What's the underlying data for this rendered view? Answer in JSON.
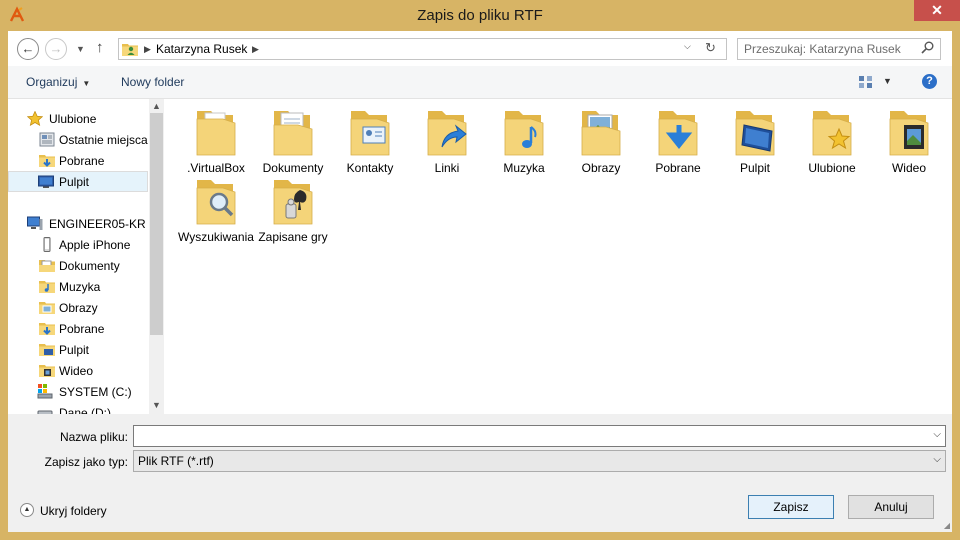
{
  "window": {
    "title": "Zapis do pliku RTF",
    "close_glyph": "✕",
    "app_icon": "app-logo-icon"
  },
  "address": {
    "back_glyph": "←",
    "forward_glyph": "→",
    "up_glyph": "↑",
    "crumbs": [
      "Katarzyna Rusek"
    ],
    "search_placeholder": "Przeszukaj: Katarzyna Rusek"
  },
  "toolbar": {
    "organize": "Organizuj",
    "new_folder": "Nowy folder",
    "help_glyph": "?"
  },
  "nav": {
    "favorites_header": "Ulubione",
    "favorites": [
      "Ostatnie miejsca",
      "Pobrane",
      "Pulpit"
    ],
    "computer_header": "ENGINEER05-KR",
    "computer": [
      "Apple iPhone",
      "Dokumenty",
      "Muzyka",
      "Obrazy",
      "Pobrane",
      "Pulpit",
      "Wideo",
      "SYSTEM (C:)",
      "Dane (D:)"
    ],
    "selected": "Pulpit"
  },
  "files": [
    {
      "label": ".VirtualBox",
      "icon": "folder-icon"
    },
    {
      "label": "Dokumenty",
      "icon": "documents-folder-icon"
    },
    {
      "label": "Kontakty",
      "icon": "contacts-folder-icon"
    },
    {
      "label": "Linki",
      "icon": "links-folder-icon"
    },
    {
      "label": "Muzyka",
      "icon": "music-folder-icon"
    },
    {
      "label": "Obrazy",
      "icon": "pictures-folder-icon"
    },
    {
      "label": "Pobrane",
      "icon": "downloads-folder-icon"
    },
    {
      "label": "Pulpit",
      "icon": "desktop-folder-icon"
    },
    {
      "label": "Ulubione",
      "icon": "favorites-folder-icon"
    },
    {
      "label": "Wideo",
      "icon": "videos-folder-icon"
    },
    {
      "label": "Wyszukiwania",
      "icon": "searches-folder-icon"
    },
    {
      "label": "Zapisane gry",
      "icon": "saved-games-folder-icon"
    }
  ],
  "form": {
    "filename_label": "Nazwa pliku:",
    "filename_value": "",
    "type_label": "Zapisz jako typ:",
    "type_value": "Plik RTF (*.rtf)"
  },
  "footer": {
    "toggle_folders": "Ukryj foldery",
    "save": "Zapisz",
    "cancel": "Anuluj"
  },
  "colors": {
    "frame": "#d7b465",
    "close": "#c7504b",
    "selection": "#e5f3fb",
    "folder": "#f3cf6a"
  }
}
